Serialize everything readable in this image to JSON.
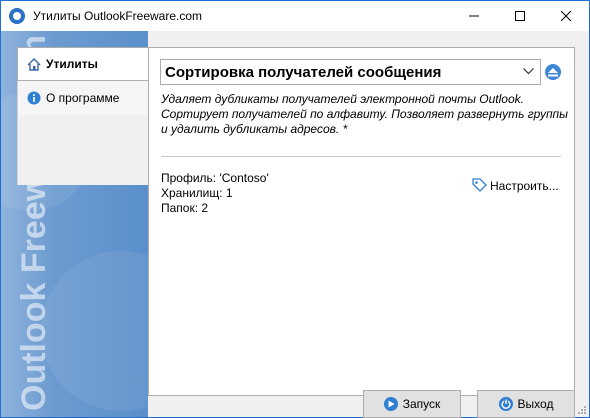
{
  "window": {
    "title": "Утилиты OutlookFreeware.com",
    "controls": [
      "minimize",
      "maximize",
      "close"
    ]
  },
  "sidebar_banner": {
    "text": "Outlook Freeware .com"
  },
  "tabs": [
    {
      "label": "Утилиты",
      "icon": "home-icon",
      "active": true
    },
    {
      "label": "О программе",
      "icon": "info-icon",
      "active": false
    }
  ],
  "main": {
    "utility_selector": {
      "selected": "Сортировка получателей сообщения"
    },
    "description": "Удаляет дубликаты получателей электронной почты Outlook. Сортирует получателей по алфавиту. Позволяет развернуть группы и удалить дубликаты адресов. *",
    "info_lines": [
      "Профиль: 'Contoso'",
      "Хранилищ: 1",
      "Папок: 2"
    ],
    "configure_label": "Настроить..."
  },
  "footer": {
    "run_label": "Запуск",
    "exit_label": "Выход"
  },
  "colors": {
    "accent": "#2f7fd3",
    "banner": "#5b8fcb",
    "border": "#1f6fd1"
  }
}
